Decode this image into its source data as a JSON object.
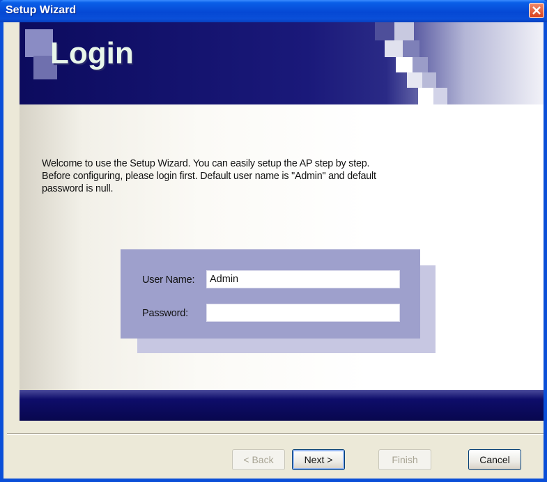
{
  "window": {
    "title": "Setup Wizard"
  },
  "banner": {
    "title": "Login"
  },
  "intro": {
    "line1": "Welcome to use the Setup Wizard. You can easily setup the AP step by step.",
    "line2": "Before configuring, please login first. Default user name is \"Admin\" and default",
    "line3": "password is null."
  },
  "form": {
    "username_label": "User Name:",
    "username_value": "Admin",
    "password_label": "Password:",
    "password_value": ""
  },
  "buttons": {
    "back": "< Back",
    "next": "Next >",
    "finish": "Finish",
    "cancel": "Cancel"
  },
  "colors": {
    "titlebar": "#0a4fd8",
    "banner": "#0c0b5e",
    "panel": "#9ea0cc",
    "footer_band": "#08074e"
  }
}
